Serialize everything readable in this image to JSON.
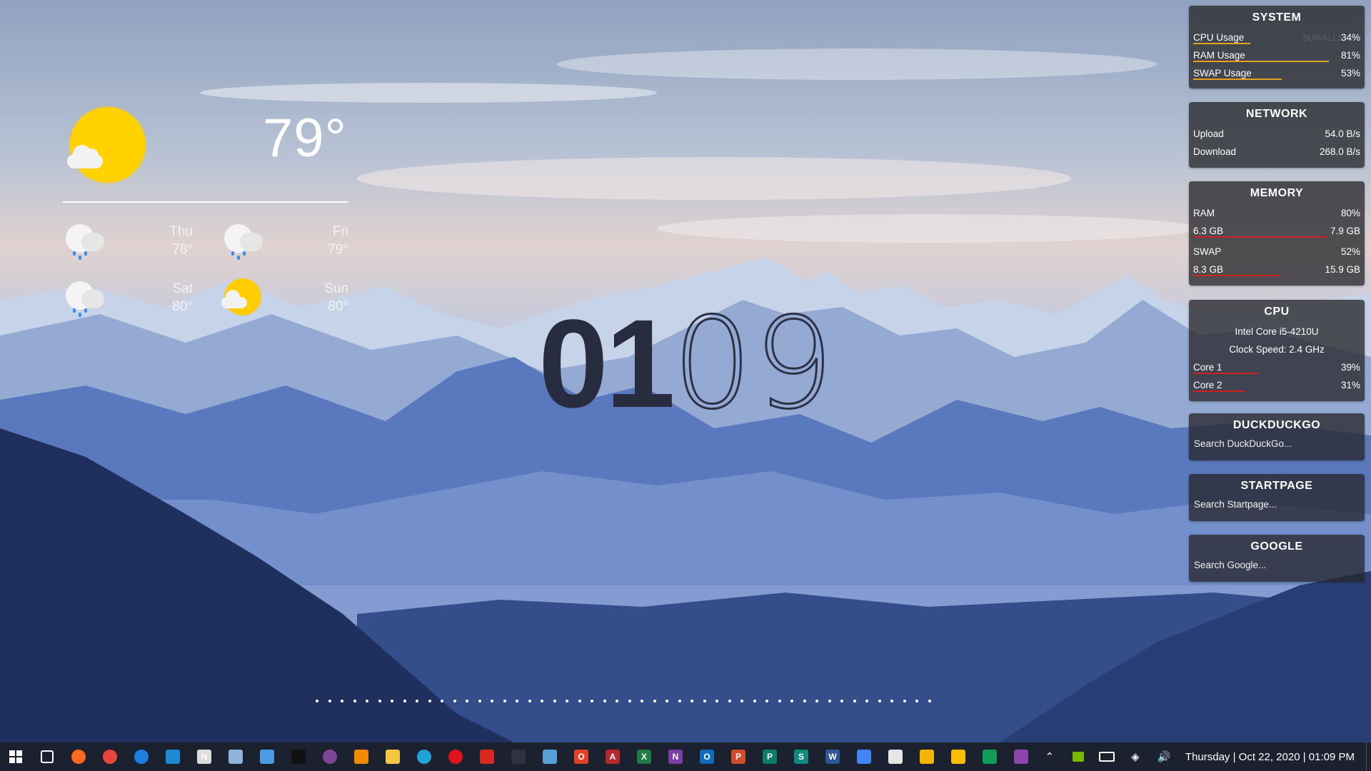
{
  "weather": {
    "current_temp": "79°",
    "forecast": [
      {
        "day": "Thu",
        "temp": "78°",
        "icon": "rain-cloud-icon"
      },
      {
        "day": "Fri",
        "temp": "79°",
        "icon": "rain-cloud-icon"
      },
      {
        "day": "Sat",
        "temp": "80°",
        "icon": "rain-cloud-icon"
      },
      {
        "day": "Sun",
        "temp": "80°",
        "icon": "sun-cloud-icon"
      }
    ]
  },
  "clock": {
    "hours": "01",
    "minutes": "09"
  },
  "panels": {
    "system": {
      "title": "SYSTEM",
      "watermark": "SUWALLS",
      "rows": [
        {
          "label": "CPU Usage",
          "value": "34%",
          "level": 0.34
        },
        {
          "label": "RAM Usage",
          "value": "81%",
          "level": 0.81
        },
        {
          "label": "SWAP Usage",
          "value": "53%",
          "level": 0.53
        }
      ]
    },
    "network": {
      "title": "NETWORK",
      "rows": [
        {
          "label": "Upload",
          "value": "54.0 B/s"
        },
        {
          "label": "Download",
          "value": "268.0 B/s"
        }
      ]
    },
    "memory": {
      "title": "MEMORY",
      "ram_label": "RAM",
      "ram_pct": "80%",
      "ram_used": "6.3 GB",
      "ram_total": "7.9 GB",
      "ram_level": 0.8,
      "swap_label": "SWAP",
      "swap_pct": "52%",
      "swap_used": "8.3 GB",
      "swap_total": "15.9 GB",
      "swap_level": 0.52
    },
    "cpu": {
      "title": "CPU",
      "model": "Intel Core i5-4210U",
      "clock": "Clock Speed: 2.4 GHz",
      "cores": [
        {
          "label": "Core 1",
          "value": "39%",
          "level": 0.39
        },
        {
          "label": "Core 2",
          "value": "31%",
          "level": 0.31
        }
      ]
    },
    "duckduckgo": {
      "title": "DUCKDUCKGO",
      "placeholder": "Search DuckDuckGo..."
    },
    "startpage": {
      "title": "STARTPAGE",
      "placeholder": "Search Startpage..."
    },
    "google": {
      "title": "GOOGLE",
      "placeholder": "Search Google..."
    }
  },
  "colors": {
    "cpu_bar": "#e8a020",
    "ram_bar": "#e8a020",
    "swap_bar": "#e8a020",
    "memory_bar": "#cc2222",
    "core_bar": "#cc2222",
    "sun": "#ffd200"
  },
  "taskbar": {
    "icons": [
      "windows-start-icon",
      "task-view-icon",
      "firefox-icon",
      "chrome-icon",
      "firefox-dev-icon",
      "vscode-icon",
      "notepad-icon",
      "calculator-icon",
      "control-panel-icon",
      "terminal-icon",
      "tor-browser-icon",
      "vlc-icon",
      "file-explorer-icon",
      "edge-icon",
      "opera-icon",
      "acrobat-icon",
      "terminal-alt-icon",
      "fiddler-icon",
      "office-icon",
      "access-icon",
      "excel-icon",
      "onenote-icon",
      "outlook-icon",
      "powerpoint-icon",
      "publisher-icon",
      "sway-icon",
      "word-icon",
      "docs-icon",
      "file-icon",
      "slides-icon",
      "keep-icon",
      "sheets-icon",
      "forms-icon"
    ],
    "tray_icons": [
      "chevron-up-icon",
      "nvidia-icon",
      "battery-icon",
      "wifi-icon",
      "volume-icon"
    ],
    "datetime": "Thursday | Oct 22, 2020 | 01:09 PM"
  }
}
